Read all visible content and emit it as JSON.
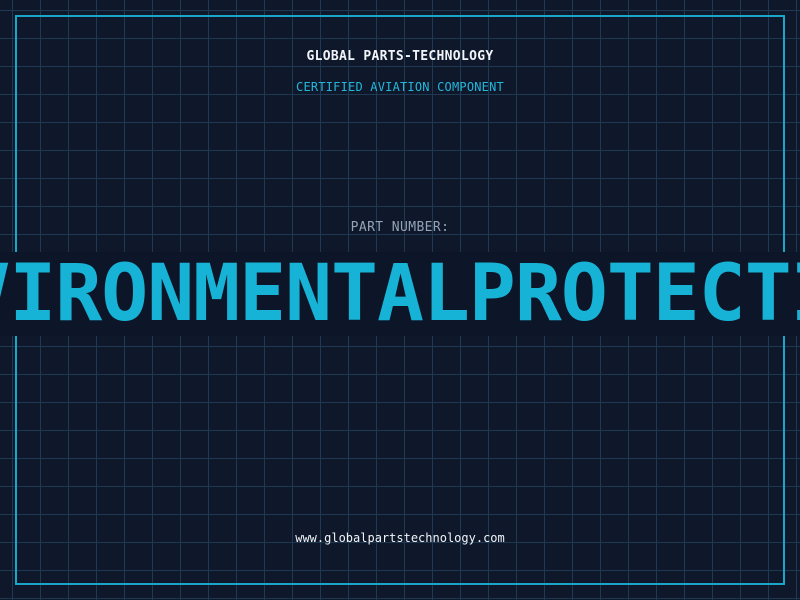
{
  "header": {
    "brand": "GLOBAL PARTS-TECHNOLOGY",
    "subtitle": "CERTIFIED AVIATION COMPONENT"
  },
  "part": {
    "label": "PART NUMBER:",
    "value": "ENVIRONMENTALPROTECTION"
  },
  "footer": {
    "website": "www.globalpartstechnology.com"
  },
  "colors": {
    "background": "#0f172a",
    "grid": "#1e3a52",
    "accent": "#17b3d6",
    "text": "#f1f5f9",
    "muted": "#94a3b8"
  }
}
